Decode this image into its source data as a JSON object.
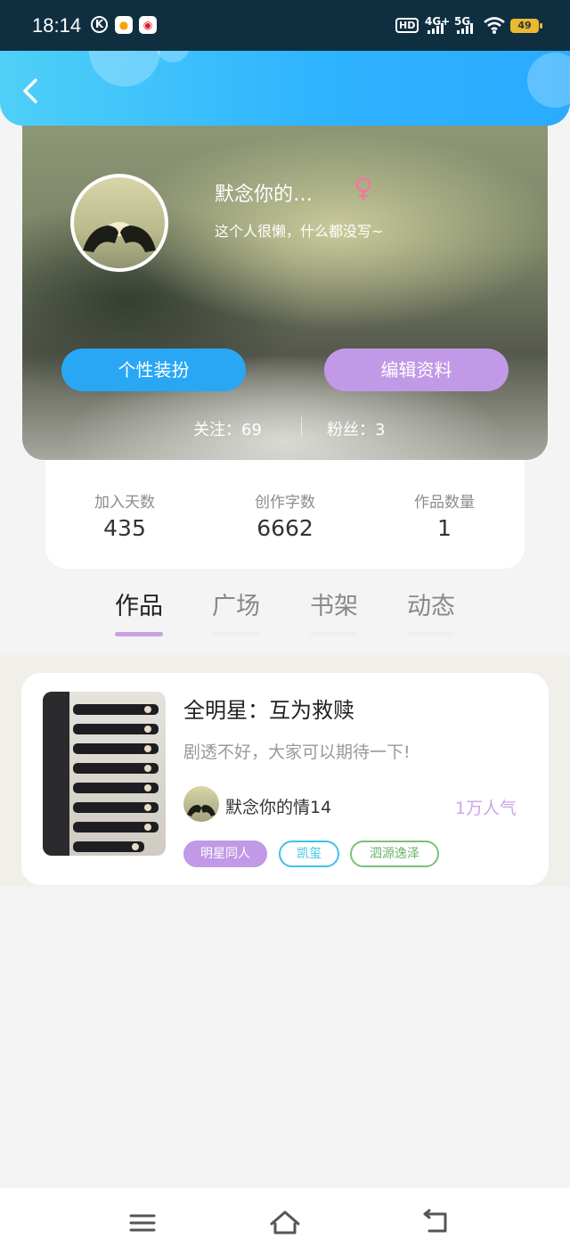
{
  "status_bar": {
    "time": "18:14",
    "k_icon_text": "K",
    "hd_text": "HD",
    "net1": "4G+",
    "net2": "5G",
    "battery": "49",
    "icons": [
      "k-icon",
      "message-app-icon",
      "weibo-icon",
      "hd-icon",
      "signal-icon",
      "wifi-icon",
      "battery-icon"
    ]
  },
  "header": {
    "back_icon": "chevron-left-icon"
  },
  "profile": {
    "name": "默念你的…",
    "gender_symbol": "♀",
    "bio": "这个人很懒，什么都没写~",
    "btn_style": "个性装扮",
    "btn_edit": "编辑资料",
    "follow": "关注：69",
    "fans": "粉丝：3"
  },
  "stats": [
    {
      "label": "加入天数",
      "value": "435"
    },
    {
      "label": "创作字数",
      "value": "6662"
    },
    {
      "label": "作品数量",
      "value": "1"
    }
  ],
  "tabs": [
    {
      "label": "作品",
      "active": true
    },
    {
      "label": "广场",
      "active": false
    },
    {
      "label": "书架",
      "active": false
    },
    {
      "label": "动态",
      "active": false
    }
  ],
  "work": {
    "title": "全明星：互为救赎",
    "desc": "剧透不好，大家可以期待一下!",
    "author": "默念你的情14",
    "popularity": "1万人气",
    "tags": [
      "明星同人",
      "凯玺",
      "泗源逸泽"
    ]
  },
  "colors": {
    "header_blue": "#2fb4ff",
    "btn_blue": "#29a7f5",
    "btn_purple": "#c199e6",
    "accent_pink": "#f07a9a"
  },
  "nav": {
    "icons": [
      "menu-icon",
      "home-icon",
      "back-icon"
    ]
  }
}
